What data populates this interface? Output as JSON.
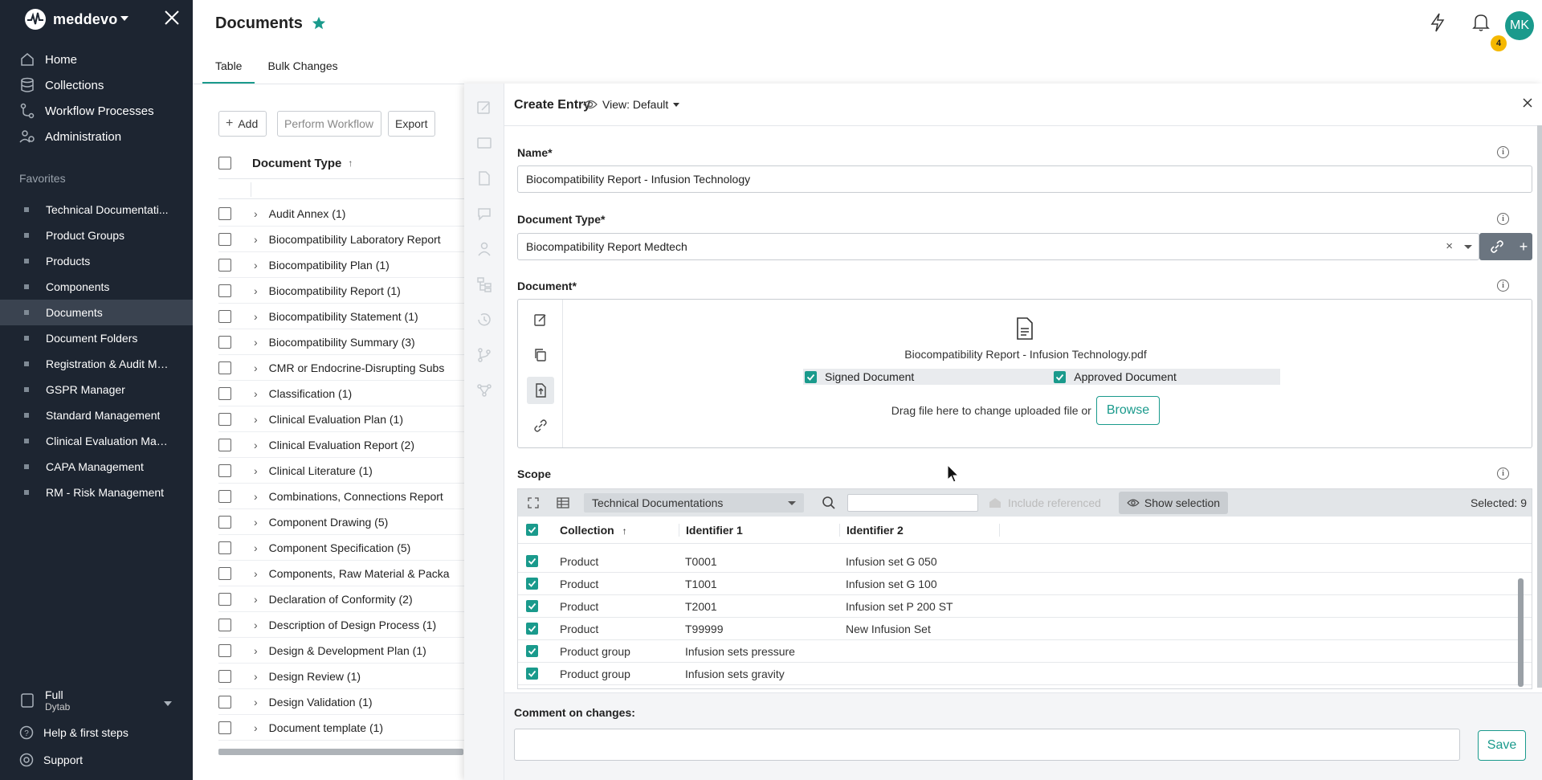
{
  "app": {
    "logo_text": "meddevo",
    "accent_color": "#1a9a8c"
  },
  "sidebar": {
    "nav": [
      {
        "label": "Home",
        "icon": "home-icon"
      },
      {
        "label": "Collections",
        "icon": "database-icon"
      },
      {
        "label": "Workflow Processes",
        "icon": "workflow-icon"
      },
      {
        "label": "Administration",
        "icon": "admin-users-icon"
      }
    ],
    "favorites_title": "Favorites",
    "favorites": [
      "Technical Documentati...",
      "Product Groups",
      "Products",
      "Components",
      "Documents",
      "Document Folders",
      "Registration & Audit Ma...",
      "GSPR Manager",
      "Standard Management",
      "Clinical Evaluation Man...",
      "CAPA Management",
      "RM - Risk Management"
    ],
    "active_favorite": "Documents",
    "workspace": {
      "name": "Full",
      "sub": "Dytab"
    },
    "help_label": "Help & first steps",
    "support_label": "Support"
  },
  "header": {
    "title": "Documents",
    "user_initials": "MK",
    "notification_count": "4"
  },
  "tabs": [
    {
      "label": "Table",
      "active": true
    },
    {
      "label": "Bulk Changes",
      "active": false
    }
  ],
  "toolbar": {
    "add_label": "Add",
    "workflow_label": "Perform Workflow",
    "export_label": "Export"
  },
  "table": {
    "column_header": "Document Type",
    "rows": [
      "Audit Annex (1)",
      "Biocompatibility Laboratory Report",
      "Biocompatibility Plan (1)",
      "Biocompatibility Report (1)",
      "Biocompatibility Statement (1)",
      "Biocompatibility Summary (3)",
      "CMR or Endocrine-Disrupting Subs",
      "Classification (1)",
      "Clinical Evaluation Plan (1)",
      "Clinical Evaluation Report (2)",
      "Clinical Literature (1)",
      "Combinations, Connections Report",
      "Component Drawing (5)",
      "Component Specification (5)",
      "Components, Raw Material & Packa",
      "Declaration of Conformity (2)",
      "Description of Design Process (1)",
      "Design & Development Plan (1)",
      "Design Review (1)",
      "Design Validation (1)",
      "Document template (1)"
    ]
  },
  "panel": {
    "title": "Create Entry",
    "view_label": "View: Default",
    "name_label": "Name*",
    "name_value": "Biocompatibility Report - Infusion Technology",
    "doctype_label": "Document Type*",
    "doctype_value": "Biocompatibility Report  Medtech",
    "document_label": "Document*",
    "file_name": "Biocompatibility Report - Infusion Technology.pdf",
    "signed_label": "Signed Document",
    "approved_label": "Approved Document",
    "drag_text": "Drag file here to change uploaded file or",
    "browse_label": "Browse",
    "scope_label": "Scope",
    "scope_collection": "Technical Documentations",
    "include_referenced": "Include referenced",
    "show_selection": "Show selection",
    "selected_text": "Selected: 9",
    "scope_columns": [
      "Collection",
      "Identifier 1",
      "Identifier 2"
    ],
    "scope_rows": [
      {
        "c1": "Product",
        "c2": "T0001",
        "c3": "Infusion set G 050"
      },
      {
        "c1": "Product",
        "c2": "T1001",
        "c3": "Infusion set G 100"
      },
      {
        "c1": "Product",
        "c2": "T2001",
        "c3": "Infusion set P 200 ST"
      },
      {
        "c1": "Product",
        "c2": "T99999",
        "c3": "New Infusion Set"
      },
      {
        "c1": "Product group",
        "c2": "Infusion sets pressure",
        "c3": ""
      },
      {
        "c1": "Product group",
        "c2": "Infusion sets gravity",
        "c3": ""
      }
    ],
    "comment_label": "Comment on changes:",
    "save_label": "Save"
  }
}
